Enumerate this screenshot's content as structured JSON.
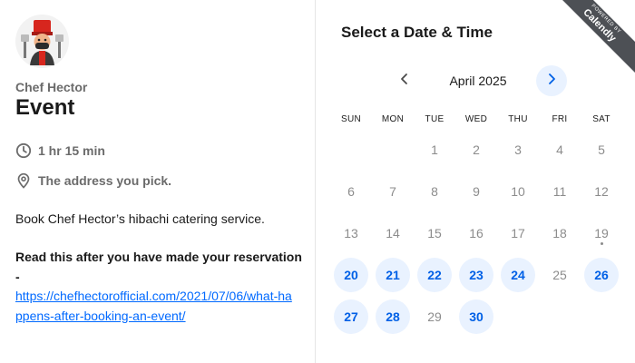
{
  "host": {
    "name": "Chef Hector"
  },
  "event": {
    "title": "Event",
    "duration": "1 hr 15 min",
    "location": "The address you pick.",
    "description": "Book Chef Hector’s hibachi catering service.",
    "notice": "Read this after you have made your reservation -",
    "link": "https://chefhectorofficial.com/2021/07/06/what-happens-after-booking-an-event/"
  },
  "calendar": {
    "heading": "Select a Date & Time",
    "month": "April 2025",
    "weekdays": [
      "SUN",
      "MON",
      "TUE",
      "WED",
      "THU",
      "FRI",
      "SAT"
    ],
    "first_weekday_index": 2,
    "today": 19,
    "days": [
      {
        "d": 1,
        "available": false
      },
      {
        "d": 2,
        "available": false
      },
      {
        "d": 3,
        "available": false
      },
      {
        "d": 4,
        "available": false
      },
      {
        "d": 5,
        "available": false
      },
      {
        "d": 6,
        "available": false
      },
      {
        "d": 7,
        "available": false
      },
      {
        "d": 8,
        "available": false
      },
      {
        "d": 9,
        "available": false
      },
      {
        "d": 10,
        "available": false
      },
      {
        "d": 11,
        "available": false
      },
      {
        "d": 12,
        "available": false
      },
      {
        "d": 13,
        "available": false
      },
      {
        "d": 14,
        "available": false
      },
      {
        "d": 15,
        "available": false
      },
      {
        "d": 16,
        "available": false
      },
      {
        "d": 17,
        "available": false
      },
      {
        "d": 18,
        "available": false
      },
      {
        "d": 19,
        "available": false
      },
      {
        "d": 20,
        "available": true
      },
      {
        "d": 21,
        "available": true
      },
      {
        "d": 22,
        "available": true
      },
      {
        "d": 23,
        "available": true
      },
      {
        "d": 24,
        "available": true
      },
      {
        "d": 25,
        "available": false
      },
      {
        "d": 26,
        "available": true
      },
      {
        "d": 27,
        "available": true
      },
      {
        "d": 28,
        "available": true
      },
      {
        "d": 29,
        "available": false
      },
      {
        "d": 30,
        "available": true
      }
    ]
  },
  "badge": {
    "top": "POWERED BY",
    "brand": "Calendly"
  },
  "colors": {
    "accent": "#0069ff",
    "available_bg": "#e9f2ff",
    "badge_bg": "#4d5055"
  },
  "icons": {
    "prev": "chevron-left-icon",
    "next": "chevron-right-icon",
    "duration": "clock-icon",
    "location": "map-pin-icon"
  }
}
